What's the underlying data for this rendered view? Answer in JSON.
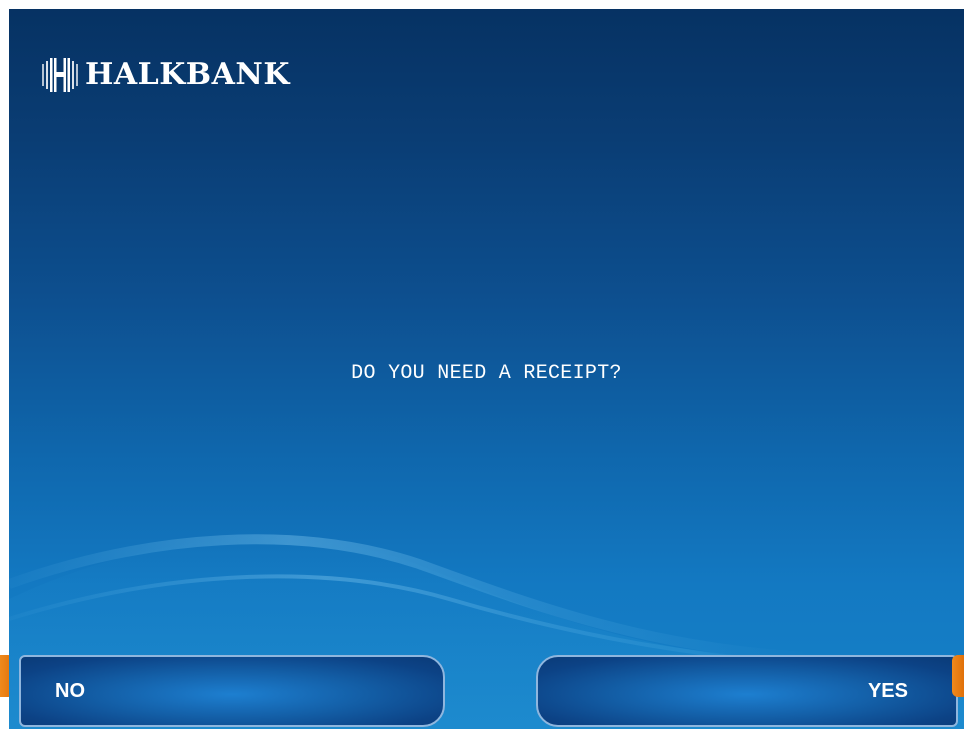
{
  "brand": {
    "name": "HALKBANK",
    "logo_icon": "halkbank-emblem-icon"
  },
  "prompt": {
    "text": "DO YOU NEED A RECEIPT?"
  },
  "function_keys": {
    "left": {
      "label": "NO",
      "accent_color": "#e8790f"
    },
    "right": {
      "label": "YES",
      "accent_color": "#e8790f"
    }
  },
  "colors": {
    "background_top": "#063263",
    "background_bottom": "#1682c9",
    "button_border": "#8fb6de",
    "text": "#ffffff"
  }
}
